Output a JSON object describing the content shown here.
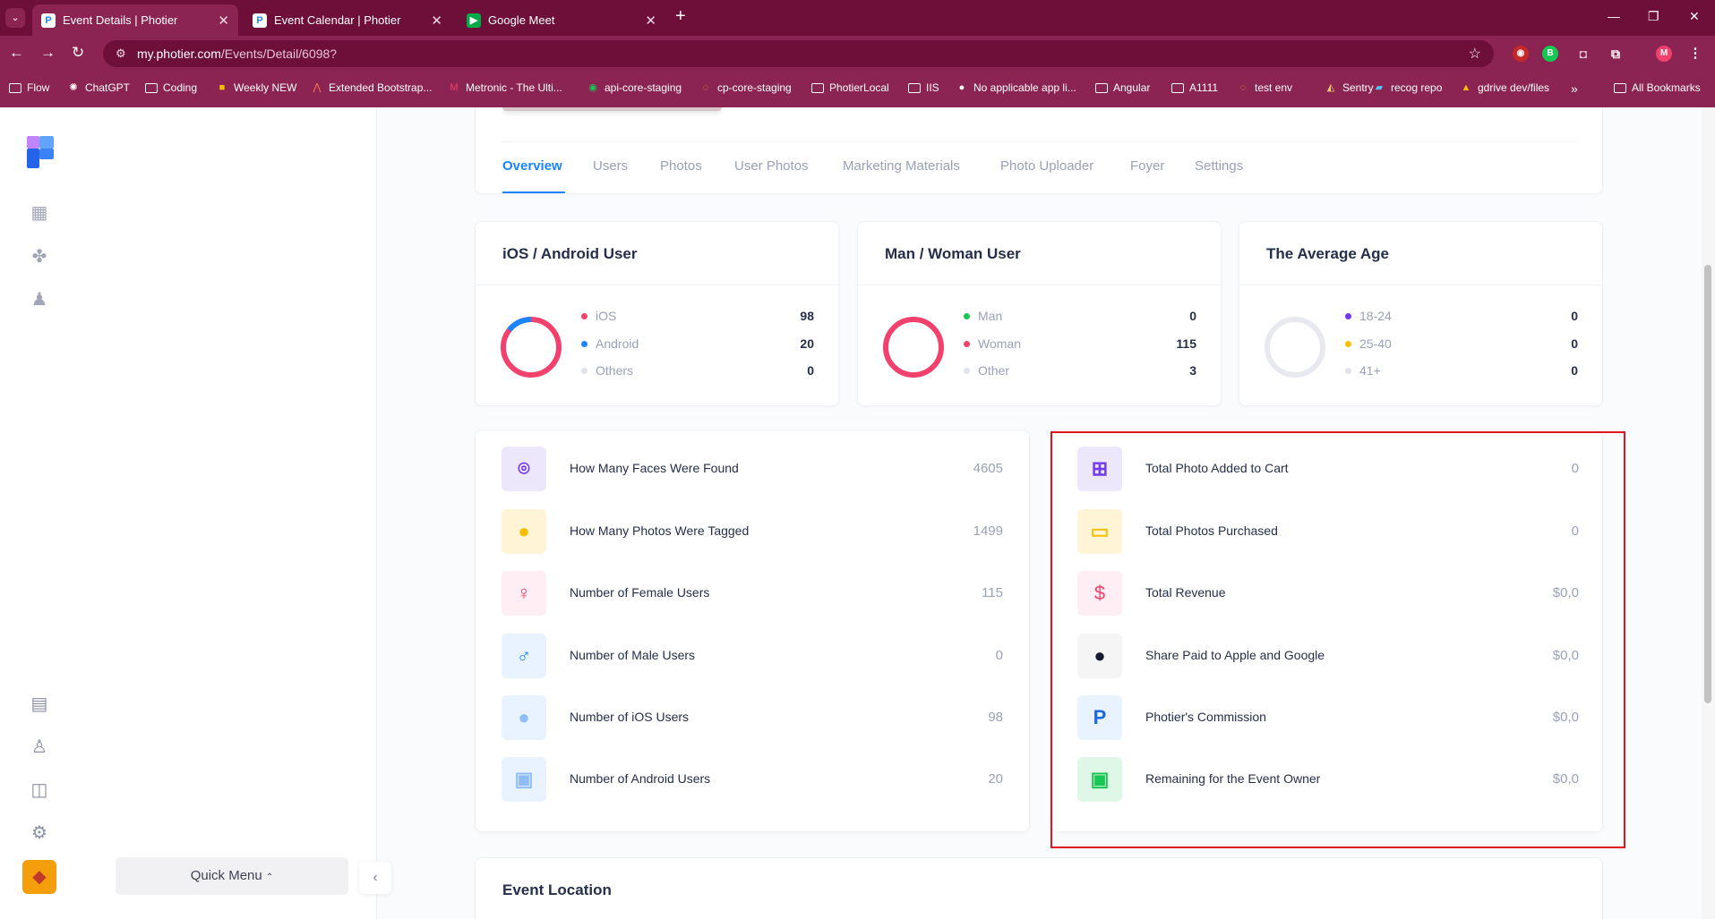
{
  "browser": {
    "tabs": [
      {
        "title": "Event Details | Photier",
        "active": true
      },
      {
        "title": "Event Calendar | Photier",
        "active": false
      },
      {
        "title": "Google Meet",
        "active": false
      }
    ],
    "address": {
      "host": "my.photier.com",
      "path": "/Events/Detail/6098?"
    },
    "bookmarks": [
      "Flow",
      "ChatGPT",
      "Coding",
      "Weekly NEW",
      "Extended Bootstrap...",
      "Metronic - The Ulti...",
      "api-core-staging",
      "cp-core-staging",
      "PhotierLocal",
      "IIS",
      "No applicable app li...",
      "Angular",
      "A1111",
      "test env",
      "Sentry",
      "recog repo",
      "gdrive dev/files"
    ],
    "all_bookmarks": "All Bookmarks",
    "profile_initial": "M",
    "ext_badge": "B"
  },
  "sidebar": {
    "quick_menu": "Quick Menu"
  },
  "event_tabs": [
    "Overview",
    "Users",
    "Photos",
    "User Photos",
    "Marketing Materials",
    "Photo Uploader",
    "Foyer",
    "Settings"
  ],
  "stats": {
    "platform": {
      "title": "iOS / Android User",
      "items": [
        {
          "label": "iOS",
          "value": "98",
          "color": "#f1416c"
        },
        {
          "label": "Android",
          "value": "20",
          "color": "#1b84ff"
        },
        {
          "label": "Others",
          "value": "0",
          "color": "#e1e3ea"
        }
      ]
    },
    "gender": {
      "title": "Man / Woman User",
      "items": [
        {
          "label": "Man",
          "value": "0",
          "color": "#17c653"
        },
        {
          "label": "Woman",
          "value": "115",
          "color": "#f1416c"
        },
        {
          "label": "Other",
          "value": "3",
          "color": "#e1e3ea"
        }
      ]
    },
    "age": {
      "title": "The Average Age",
      "items": [
        {
          "label": "18-24",
          "value": "0",
          "color": "#7239ea"
        },
        {
          "label": "25-40",
          "value": "0",
          "color": "#f6c000"
        },
        {
          "label": "41+",
          "value": "0",
          "color": "#e1e3ea"
        }
      ]
    }
  },
  "metrics_left": [
    {
      "label": "How Many Faces Were Found",
      "value": "4605",
      "icon": "face-scan-icon",
      "bg": "#ede7fb",
      "fg": "#7239ea"
    },
    {
      "label": "How Many Photos Were Tagged",
      "value": "1499",
      "icon": "tagged-people-icon",
      "bg": "#fff5d6",
      "fg": "#f6c000"
    },
    {
      "label": "Number of Female Users",
      "value": "115",
      "icon": "female-icon",
      "bg": "#ffeef3",
      "fg": "#f1416c"
    },
    {
      "label": "Number of Male Users",
      "value": "0",
      "icon": "male-icon",
      "bg": "#e9f3ff",
      "fg": "#1b84ff"
    },
    {
      "label": "Number of iOS Users",
      "value": "98",
      "icon": "apple-icon",
      "bg": "#e9f3ff",
      "fg": "#8fbdf5"
    },
    {
      "label": "Number of Android Users",
      "value": "20",
      "icon": "android-icon",
      "bg": "#e9f3ff",
      "fg": "#8fbdf5"
    }
  ],
  "metrics_right": [
    {
      "label": "Total Photo Added to Cart",
      "value": "0",
      "icon": "cart-icon",
      "bg": "#ede7fb",
      "fg": "#7239ea"
    },
    {
      "label": "Total Photos Purchased",
      "value": "0",
      "icon": "credit-card-icon",
      "bg": "#fff5d6",
      "fg": "#f6c000"
    },
    {
      "label": "Total Revenue",
      "value": "$0,0",
      "icon": "dollar-icon",
      "bg": "#ffeef3",
      "fg": "#f1416c"
    },
    {
      "label": "Share Paid to Apple and Google",
      "value": "$0,0",
      "icon": "apple-icon",
      "bg": "#f5f5f5",
      "fg": "#181c32"
    },
    {
      "label": "Photier's Commission",
      "value": "$0,0",
      "icon": "p-letter-icon",
      "bg": "#e9f3ff",
      "fg": "#1b6ae0"
    },
    {
      "label": "Remaining for the Event Owner",
      "value": "$0,0",
      "icon": "id-badge-icon",
      "bg": "#dff7e7",
      "fg": "#17c653"
    }
  ],
  "location": {
    "title": "Event Location"
  }
}
